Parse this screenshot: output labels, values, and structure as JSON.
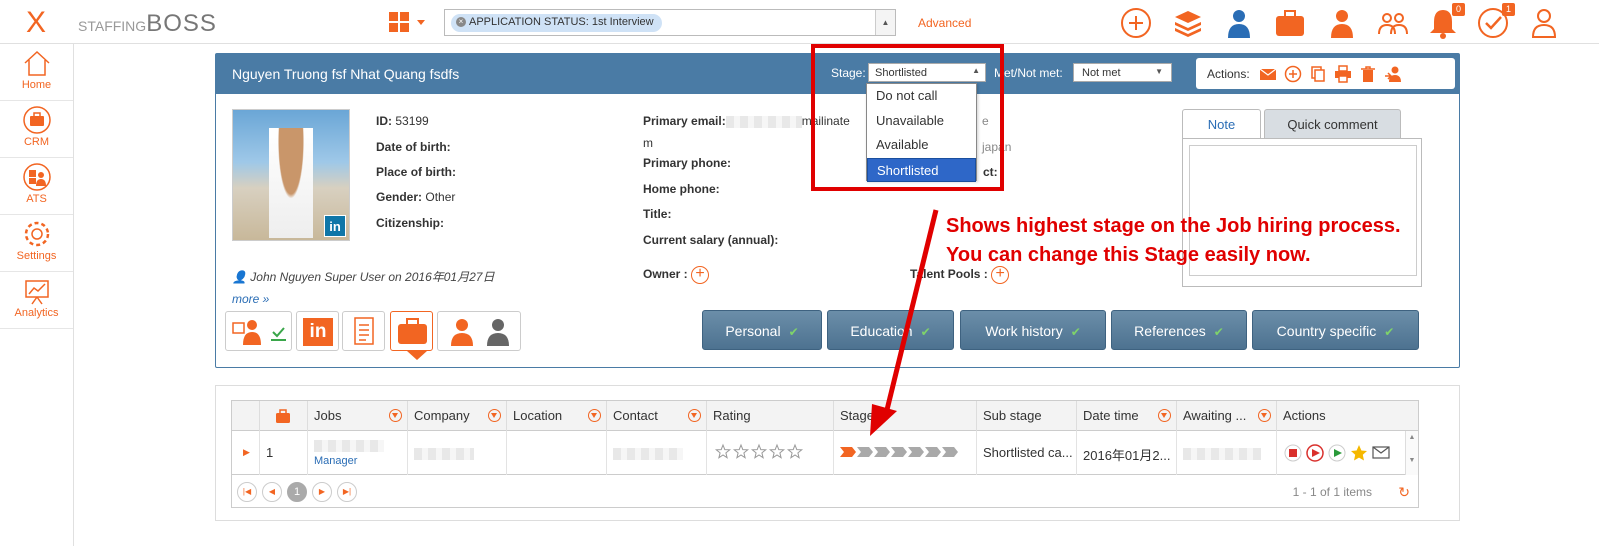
{
  "brand": {
    "logo": "X",
    "name_prefix": "STAFFING",
    "name_suffix": "BOSS"
  },
  "search": {
    "chip": "APPLICATION STATUS: 1st Interview",
    "advanced": "Advanced"
  },
  "top_badges": {
    "notifications": "0",
    "tasks": "1"
  },
  "sidebar": {
    "items": [
      {
        "label": "Home",
        "icon": "home-icon"
      },
      {
        "label": "CRM",
        "icon": "briefcase-icon"
      },
      {
        "label": "ATS",
        "icon": "ats-icon"
      },
      {
        "label": "Settings",
        "icon": "gear-icon"
      },
      {
        "label": "Analytics",
        "icon": "chart-icon"
      }
    ]
  },
  "candidate": {
    "name": "Nguyen Truong fsf Nhat Quang fsdfs",
    "stage_label": "Stage:",
    "stage_value": "Shortlisted",
    "met_label": "Met/Not met:",
    "met_value": "Not met",
    "actions_label": "Actions:",
    "id_label": "ID:",
    "id_value": "53199",
    "dob_label": "Date of birth:",
    "pob_label": "Place of birth:",
    "gender_label": "Gender:",
    "gender_value": "Other",
    "citizenship_label": "Citizenship:",
    "email_label": "Primary email:",
    "email_tail": "mailinate",
    "email_wrap": "m",
    "primary_phone_label": "Primary phone:",
    "home_phone_label": "Home phone:",
    "title_label": "Title:",
    "salary_label": "Current salary (annual):",
    "owner_label": "Owner :",
    "talent_label": "Talent Pools :",
    "right_partial_1": "e",
    "right_partial_2": "japan",
    "right_partial_3": "ct:",
    "created_by": "John Nguyen Super User on 2016年01月27日",
    "more": "more »"
  },
  "note_tabs": [
    "Note",
    "Quick comment"
  ],
  "section_tabs": [
    "Personal",
    "Education",
    "Work history",
    "References",
    "Country specific"
  ],
  "stage_options": [
    "Do not call",
    "Unavailable",
    "Available",
    "Shortlisted"
  ],
  "annotation": [
    "Shows highest stage on the Job hiring process.",
    "You can change this Stage easily now."
  ],
  "grid": {
    "columns": [
      "Jobs",
      "Company",
      "Location",
      "Contact",
      "Rating",
      "Stage",
      "Sub stage",
      "Date time",
      "Awaiting ...",
      "Actions"
    ],
    "row": {
      "index": "1",
      "job_tail": "Manager",
      "sub_stage": "Shortlisted ca...",
      "date": "2016年01月2..."
    },
    "rating": 0,
    "stage_progress": 1,
    "stage_total": 7,
    "page": "1",
    "info": "1 - 1 of 1 items"
  },
  "colors": {
    "accent": "#f26522",
    "header": "#4a7ba5",
    "annotation": "#e00000",
    "selected": "#2e67c8"
  }
}
